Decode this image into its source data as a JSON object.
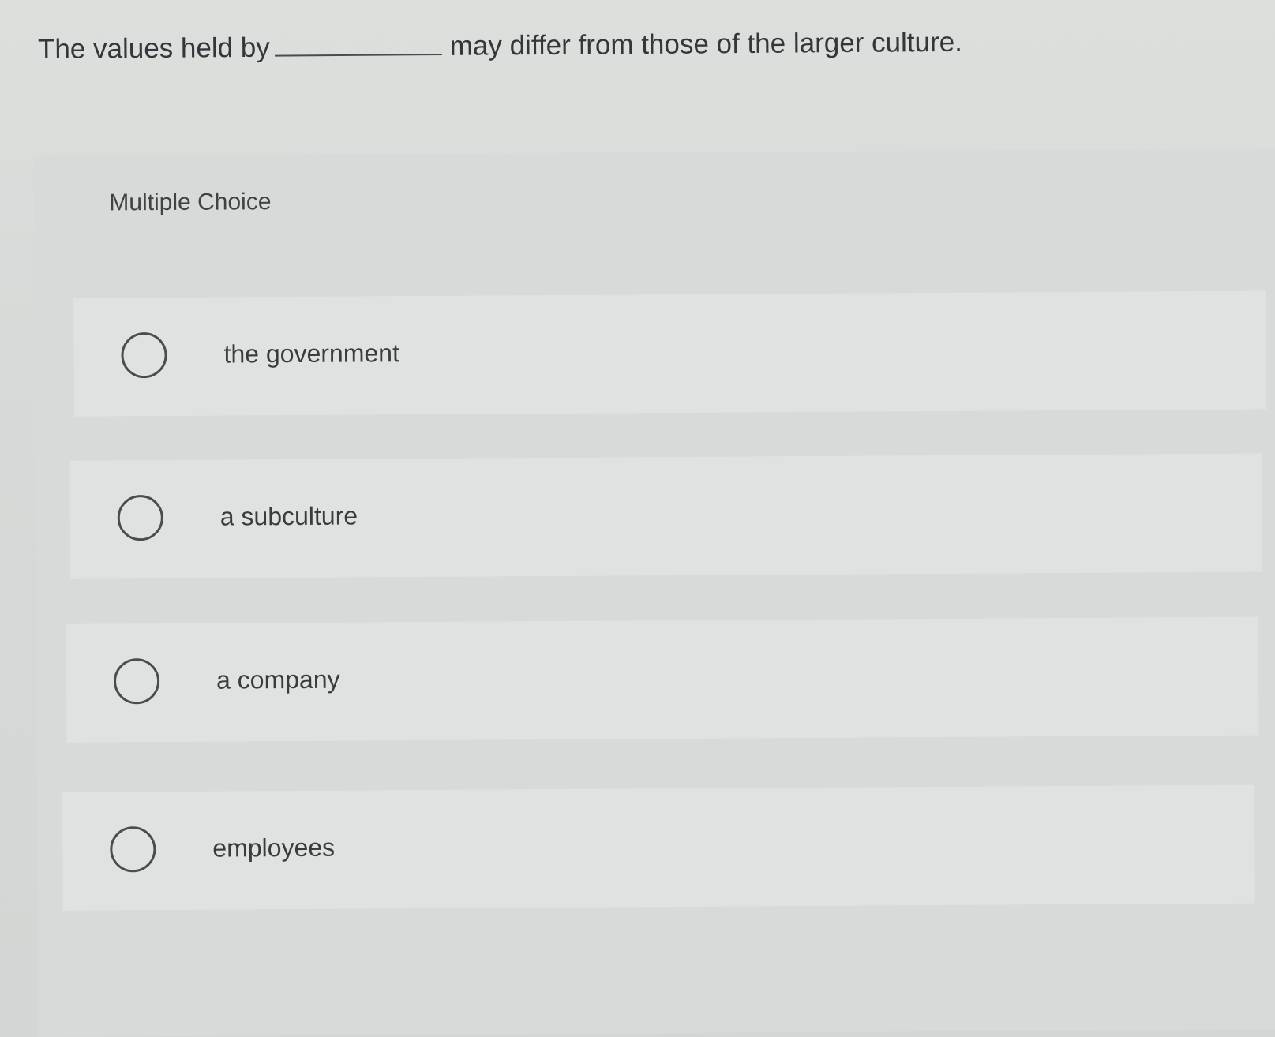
{
  "question": {
    "before_blank": "The values held by",
    "after_blank": "may differ from those of the larger culture."
  },
  "section_label": "Multiple Choice",
  "options": [
    {
      "label": "the government",
      "selected": false
    },
    {
      "label": "a subculture",
      "selected": false
    },
    {
      "label": "a company",
      "selected": false
    },
    {
      "label": "employees",
      "selected": false
    }
  ],
  "colors": {
    "background": "#d6d9d7",
    "option_background": "#dfe2e0",
    "text": "#3a3b3f",
    "radio_border": "#4a4c52"
  }
}
